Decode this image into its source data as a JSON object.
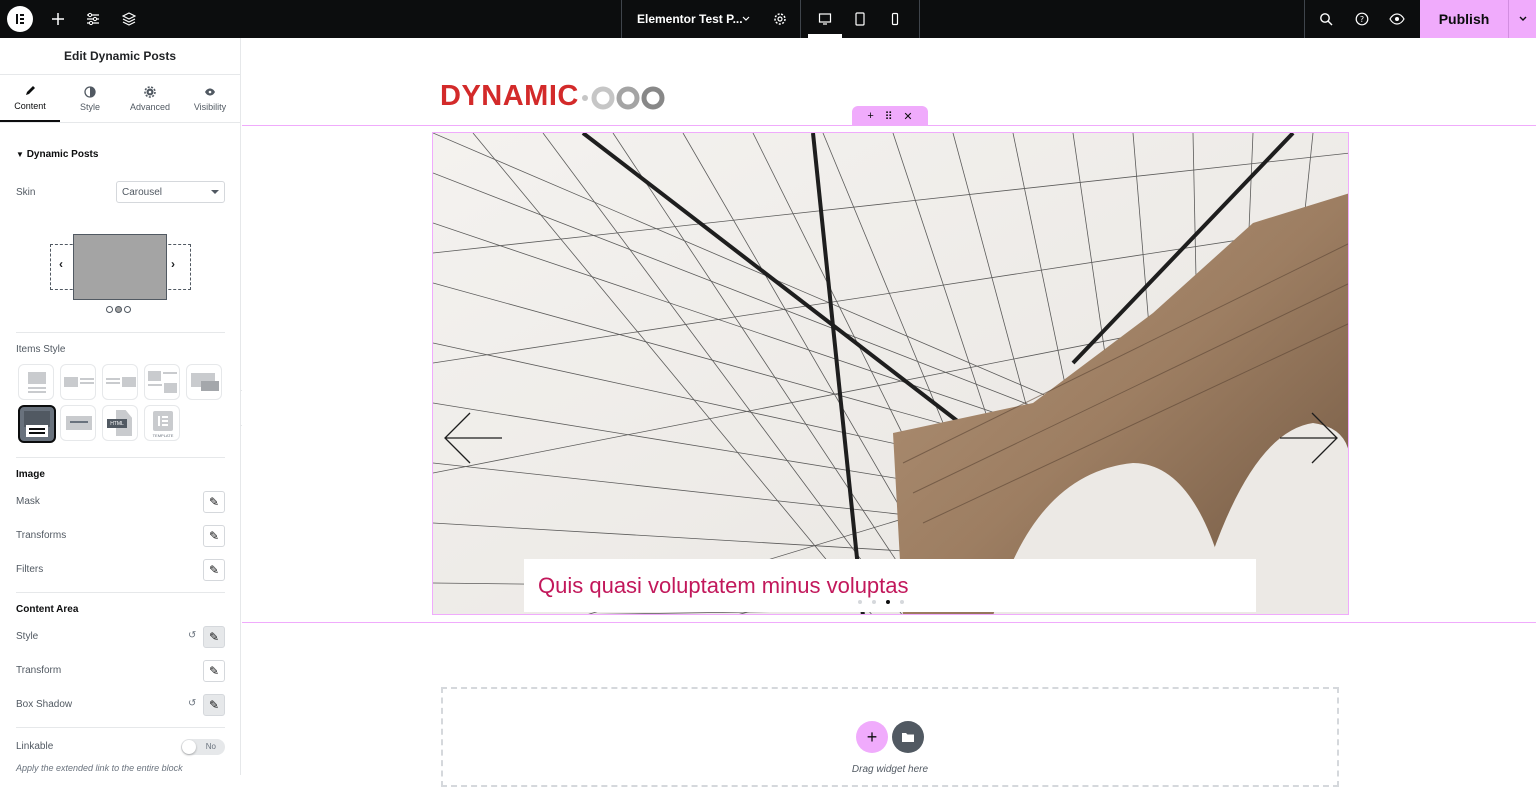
{
  "topbar": {
    "page_title": "Elementor Test P...",
    "publish_label": "Publish",
    "icons": [
      "elementor-logo-icon",
      "plus-icon",
      "sliders-icon",
      "layers-icon",
      "chevron-down-icon",
      "gear-icon",
      "desktop-icon",
      "tablet-icon",
      "mobile-icon",
      "search-icon",
      "help-icon",
      "eye-icon",
      "chevron-down-icon"
    ]
  },
  "panel": {
    "title": "Edit Dynamic Posts",
    "tabs": [
      {
        "label": "Content",
        "icon": "pencil-icon"
      },
      {
        "label": "Style",
        "icon": "half-circle-icon"
      },
      {
        "label": "Advanced",
        "icon": "gear-icon"
      },
      {
        "label": "Visibility",
        "icon": "eye-icon"
      }
    ],
    "section_title": "Dynamic Posts",
    "skin_label": "Skin",
    "skin_value": "Carousel",
    "items_style_label": "Items Style",
    "template_thumb_label": "TEMPLATE",
    "html_thumb_label": "HTML",
    "image_heading": "Image",
    "mask_label": "Mask",
    "transforms_label": "Transforms",
    "filters_label": "Filters",
    "content_area_heading": "Content Area",
    "style_label": "Style",
    "transform_label": "Transform",
    "box_shadow_label": "Box Shadow",
    "linkable_label": "Linkable",
    "linkable_value": "No",
    "linkable_hint": "Apply the extended link to the entire block"
  },
  "canvas": {
    "brand_text": "DYNAMIC",
    "caption": "Quis quasi voluptatem minus voluptas",
    "dots_count": 4,
    "active_dot": 2,
    "drag_text": "Drag widget here"
  },
  "colors": {
    "accent": "#f0abfc",
    "caption": "#c2185b",
    "brand": "#d32a2a"
  }
}
